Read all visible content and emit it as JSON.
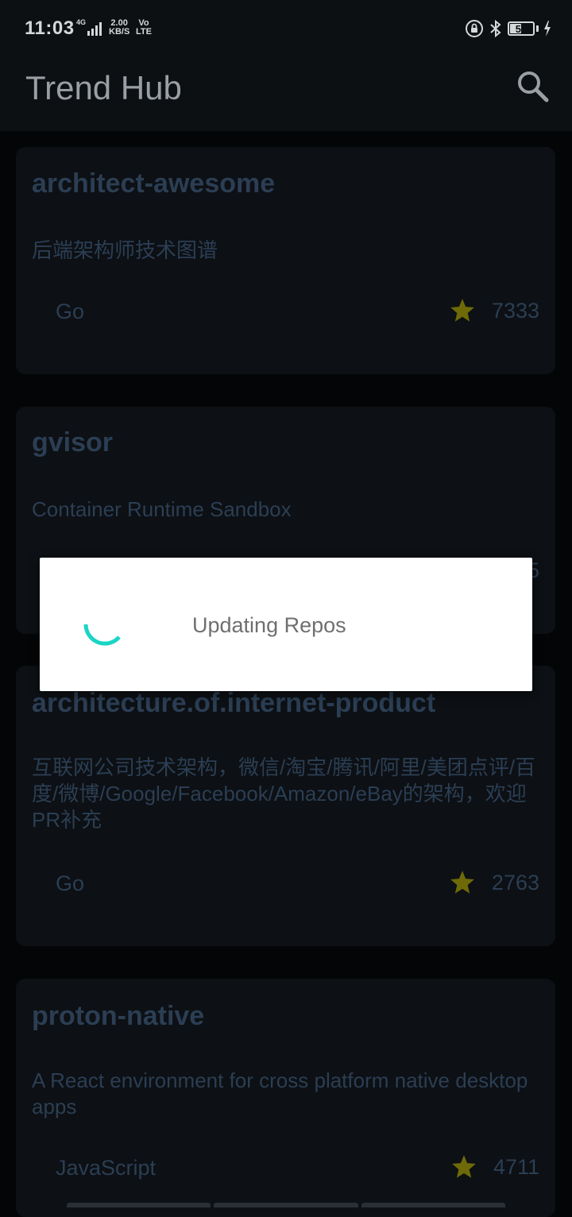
{
  "status_bar": {
    "time": "11:03",
    "network": "4G",
    "speed_value": "2.00",
    "speed_unit": "KB/S",
    "volte_top": "Vo",
    "volte_bottom": "LTE",
    "battery_level": "51",
    "icons": [
      "lock-rotation-icon",
      "bluetooth-icon",
      "battery-icon",
      "charging-icon"
    ]
  },
  "app_bar": {
    "title": "Trend Hub",
    "search_icon": "search-icon"
  },
  "repos": [
    {
      "name": "architect-awesome",
      "description": "后端架构师技术图谱",
      "language": "Go",
      "stars": "7333"
    },
    {
      "name": "gvisor",
      "description": "Container Runtime Sandbox",
      "language": "",
      "stars": "5"
    },
    {
      "name": "architecture.of.internet-product",
      "description": "互联网公司技术架构，微信/淘宝/腾讯/阿里/美团点评/百度/微博/Google/Facebook/Amazon/eBay的架构，欢迎PR补充",
      "language": "Go",
      "stars": "2763"
    },
    {
      "name": "proton-native",
      "description": "A React environment for cross platform native desktop apps",
      "language": "JavaScript",
      "stars": "4711"
    }
  ],
  "dialog": {
    "message": "Updating Repos",
    "spinner_color": "#1ad5c4"
  },
  "colors": {
    "background": "#040506",
    "card": "#0d1014",
    "card_text": "#2b3e54",
    "star": "#6e6a08",
    "title": "#9a9fa4"
  }
}
